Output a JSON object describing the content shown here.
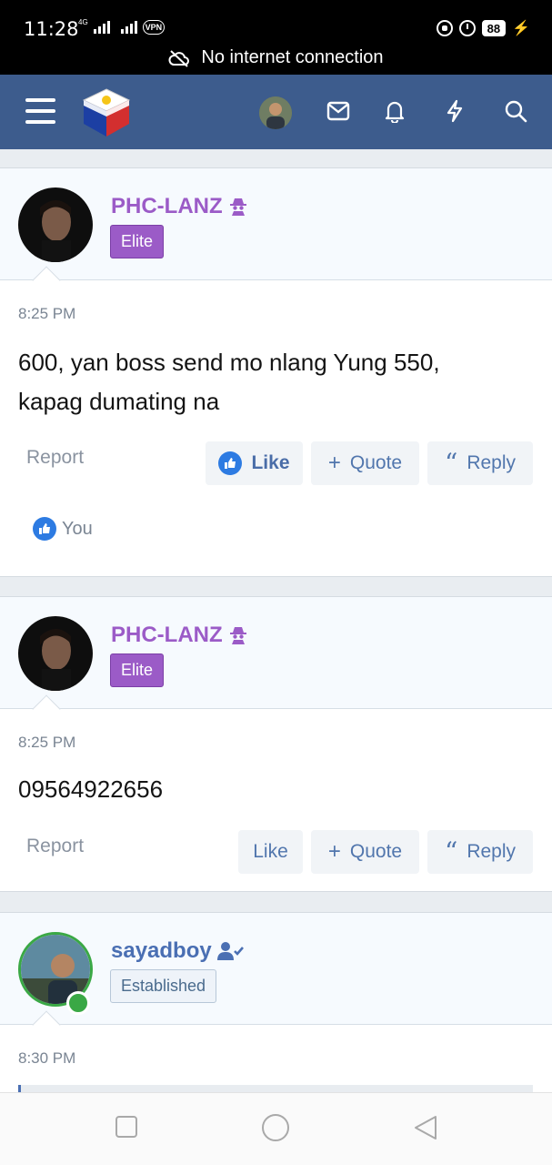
{
  "status_bar": {
    "time": "11:28",
    "network_label": "4G",
    "vpn_label": "VPN",
    "battery": "88",
    "connection_message": "No internet connection"
  },
  "header": {
    "menu_icon": "hamburger-menu-icon",
    "logo_icon": "philippine-cube-logo",
    "icons": [
      "mail-icon",
      "bell-icon",
      "bolt-icon",
      "search-icon"
    ]
  },
  "posts": [
    {
      "username": "PHC-LANZ",
      "user_icon": "spy-icon",
      "badge": "Elite",
      "time": "8:25 PM",
      "body_lines": [
        "600, yan boss send mo nlang Yung 550,",
        "kapag dumating na"
      ],
      "report": "Report",
      "like": "Like",
      "quote": "Quote",
      "reply": "Reply",
      "reaction": "You"
    },
    {
      "username": "PHC-LANZ",
      "user_icon": "spy-icon",
      "badge": "Elite",
      "time": "8:25 PM",
      "body_lines": [
        "09564922656"
      ],
      "report": "Report",
      "like": "Like",
      "quote": "Quote",
      "reply": "Reply"
    },
    {
      "username": "sayadboy",
      "user_icon": "verified-user-icon",
      "badge": "Established",
      "time": "8:30 PM"
    }
  ],
  "colors": {
    "header_bg": "#3d5c8d",
    "elite": "#9b5bc7",
    "link_blue": "#4a6fb3",
    "like_blue": "#2d7be2"
  }
}
